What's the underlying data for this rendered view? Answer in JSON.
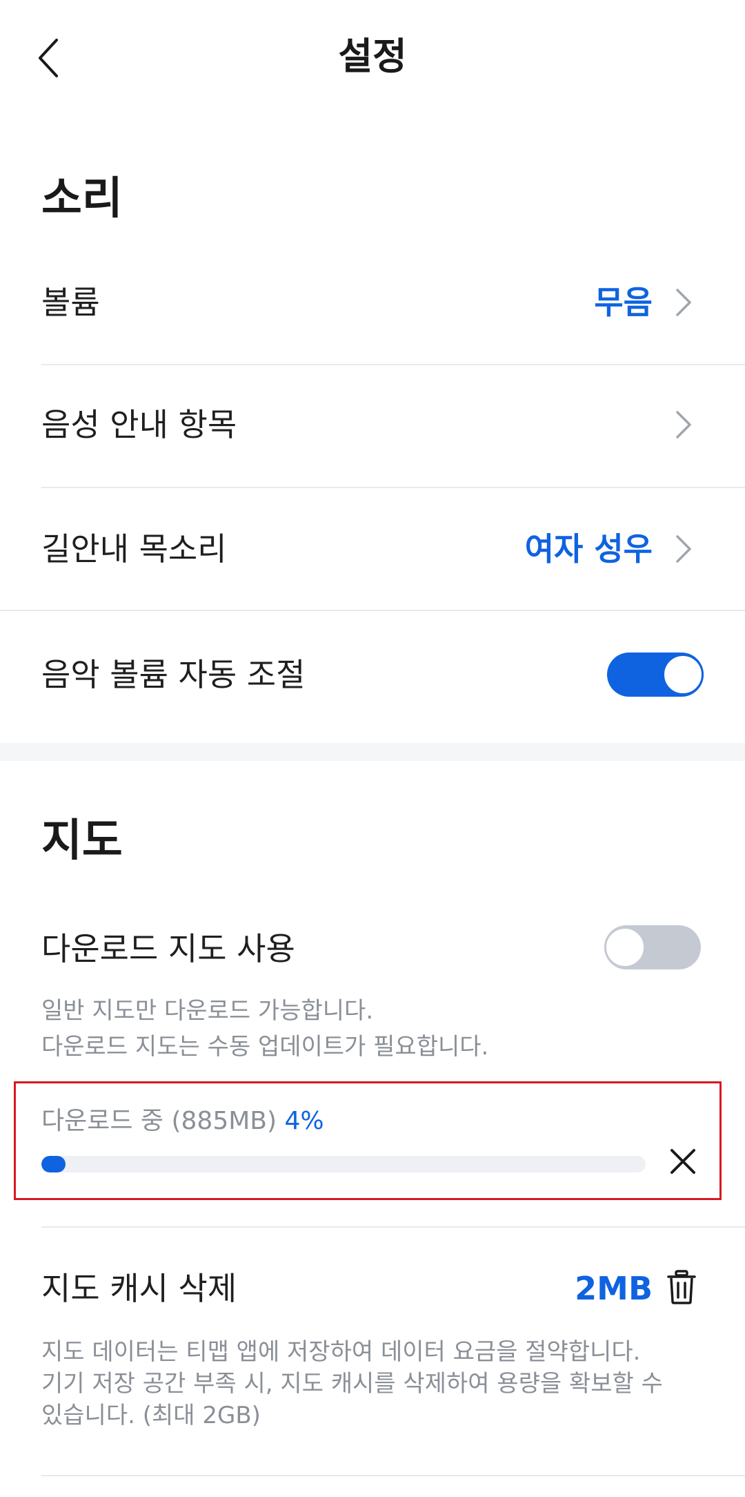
{
  "header": {
    "title": "설정"
  },
  "sound": {
    "title": "소리",
    "volume": {
      "label": "볼륨",
      "value": "무음"
    },
    "voice_items": {
      "label": "음성 안내 항목"
    },
    "guide_voice": {
      "label": "길안내 목소리",
      "value": "여자 성우"
    },
    "music_auto": {
      "label": "음악 볼륨 자동 조절",
      "enabled": true
    }
  },
  "map": {
    "title": "지도",
    "download_map": {
      "label": "다운로드 지도 사용",
      "enabled": false,
      "desc_line1": "일반 지도만 다운로드 가능합니다.",
      "desc_line2": "다운로드 지도는 수동 업데이트가 필요합니다."
    },
    "download_status": {
      "label": "다운로드 중 (885MB)",
      "percent_text": "4%",
      "progress": 0.04
    },
    "cache": {
      "label": "지도 캐시 삭제",
      "value": "2MB",
      "desc_line1": "지도 데이터는 티맵 앱에 저장하여 데이터 요금을 절약합니다.",
      "desc_line2": "기기 저장 공간 부족 시, 지도 캐시를 삭제하여 용량을 확보할 수",
      "desc_line3": "있습니다. (최대 2GB)"
    }
  },
  "colors": {
    "accent": "#0f63e0",
    "highlight_border": "#d71920"
  },
  "icons": {
    "back": "chevron-left-icon",
    "chevron": "chevron-right-icon",
    "close": "close-icon",
    "trash": "trash-icon"
  }
}
